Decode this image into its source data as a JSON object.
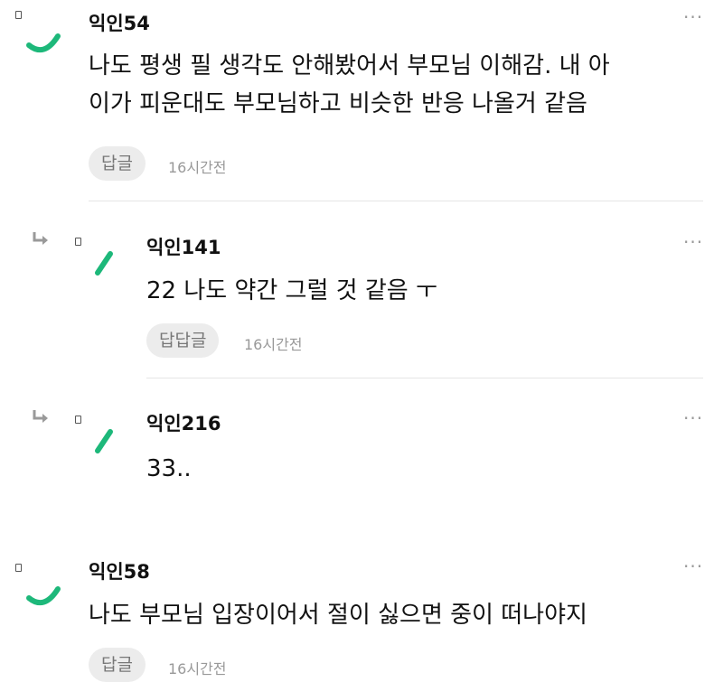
{
  "comments": [
    {
      "author": "익인54",
      "text": "나도 평생 필 생각도 안해봤어서 부모님 이해감. 내 아\n이가 피운대도 부모님하고 비슷한 반응 나올거 같음",
      "reply_label": "답글",
      "time": "16시간전"
    },
    {
      "author": "익인141",
      "text": "22 나도 약간 그럴 것 같음 ㅜ",
      "reply_label": "답답글",
      "time": "16시간전"
    },
    {
      "author": "익인216",
      "text": "33..",
      "reply_label": "",
      "time": ""
    },
    {
      "author": "익인58",
      "text": "나도 부모님 입장이어서 절이 싫으면 중이 떠나야지",
      "reply_label": "답글",
      "time": "16시간전"
    }
  ],
  "more_label": "···",
  "colors": {
    "accent": "#1db87a",
    "reply_arrow": "#9a9a9a"
  },
  "icons": {
    "avatar": "leaf-icon",
    "reply": "reply-arrow-icon",
    "more": "more-dots-icon"
  }
}
